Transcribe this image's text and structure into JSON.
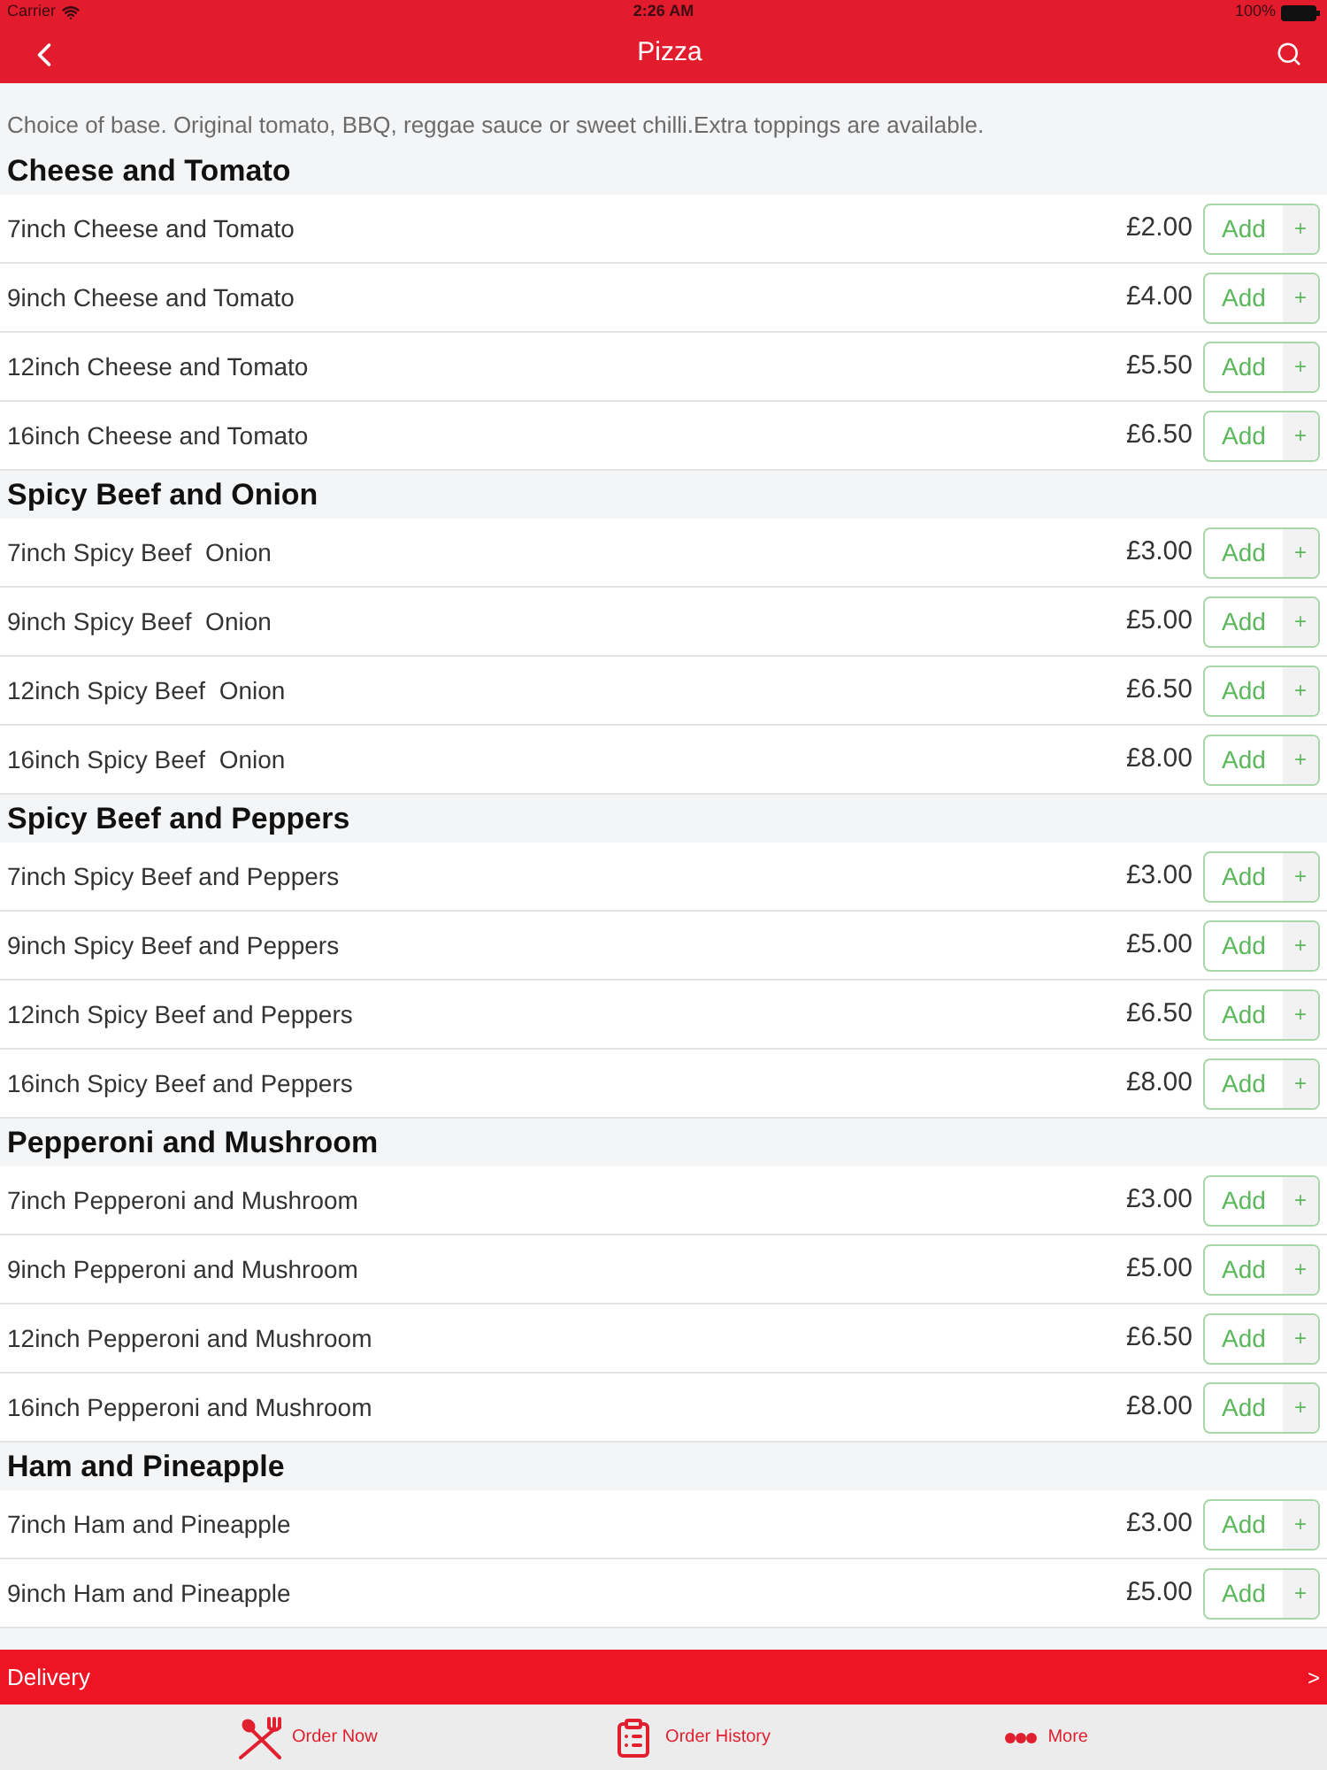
{
  "status_bar": {
    "carrier": "Carrier",
    "time": "2:26 AM",
    "battery": "100%"
  },
  "nav_bar": {
    "title": "Pizza"
  },
  "description": "Choice of base. Original tomato, BBQ, reggae sauce or sweet chilli.Extra toppings are available.",
  "sections": [
    {
      "title": "Cheese and Tomato",
      "items": [
        {
          "name": "7inch Cheese and Tomato",
          "price": "£2.00",
          "button": "Add",
          "button_sign": "+"
        },
        {
          "name": "9inch Cheese and Tomato",
          "price": "£4.00",
          "button": "Add",
          "button_sign": "+"
        },
        {
          "name": "12inch Cheese and Tomato",
          "price": "£5.50",
          "button": "Add",
          "button_sign": "+"
        },
        {
          "name": "16inch Cheese and Tomato",
          "price": "£6.50",
          "button": "Add",
          "button_sign": "+"
        }
      ]
    },
    {
      "title": "Spicy Beef and Onion",
      "items": [
        {
          "name": "7inch Spicy Beef  Onion",
          "price": "£3.00",
          "button": "Add",
          "button_sign": "+"
        },
        {
          "name": "9inch Spicy Beef  Onion",
          "price": "£5.00",
          "button": "Add",
          "button_sign": "+"
        },
        {
          "name": "12inch Spicy Beef  Onion",
          "price": "£6.50",
          "button": "Add",
          "button_sign": "+"
        },
        {
          "name": "16inch Spicy Beef  Onion",
          "price": "£8.00",
          "button": "Add",
          "button_sign": "+"
        }
      ]
    },
    {
      "title": "Spicy Beef and Peppers",
      "items": [
        {
          "name": "7inch Spicy Beef and Peppers",
          "price": "£3.00",
          "button": "Add",
          "button_sign": "+"
        },
        {
          "name": "9inch Spicy Beef and Peppers",
          "price": "£5.00",
          "button": "Add",
          "button_sign": "+"
        },
        {
          "name": "12inch Spicy Beef and Peppers",
          "price": "£6.50",
          "button": "Add",
          "button_sign": "+"
        },
        {
          "name": "16inch Spicy Beef and Peppers",
          "price": "£8.00",
          "button": "Add",
          "button_sign": "+"
        }
      ]
    },
    {
      "title": "Pepperoni and Mushroom",
      "items": [
        {
          "name": "7inch Pepperoni and Mushroom",
          "price": "£3.00",
          "button": "Add",
          "button_sign": "+"
        },
        {
          "name": "9inch Pepperoni and Mushroom",
          "price": "£5.00",
          "button": "Add",
          "button_sign": "+"
        },
        {
          "name": "12inch Pepperoni and Mushroom",
          "price": "£6.50",
          "button": "Add",
          "button_sign": "+"
        },
        {
          "name": "16inch Pepperoni and Mushroom",
          "price": "£8.00",
          "button": "Add",
          "button_sign": "+"
        }
      ]
    },
    {
      "title": "Ham and Pineapple",
      "items": [
        {
          "name": "7inch Ham and Pineapple",
          "price": "£3.00",
          "button": "Add",
          "button_sign": "+"
        },
        {
          "name": "9inch Ham and Pineapple",
          "price": "£5.00",
          "button": "Add",
          "button_sign": "+"
        }
      ]
    }
  ],
  "delivery_bar": {
    "label": "Delivery",
    "arrow": ">"
  },
  "tab_bar": [
    {
      "label": "Order Now"
    },
    {
      "label": "Order History"
    },
    {
      "label": "More"
    }
  ]
}
